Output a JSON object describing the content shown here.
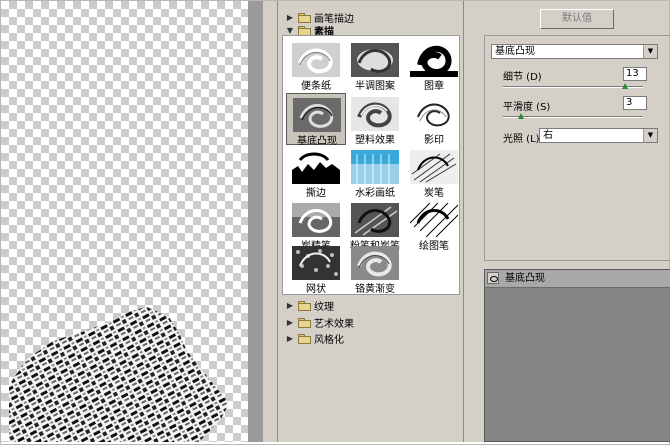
{
  "gallery": {
    "categories_top": [
      {
        "label": "画笔描边",
        "expanded": false
      }
    ],
    "active_category": {
      "label": "素描",
      "expanded": true
    },
    "thumbnails": [
      {
        "label": "便条纸",
        "selected": false
      },
      {
        "label": "半调图案",
        "selected": false
      },
      {
        "label": "图章",
        "selected": false
      },
      {
        "label": "基底凸现",
        "selected": true
      },
      {
        "label": "塑料效果",
        "selected": false
      },
      {
        "label": "影印",
        "selected": false
      },
      {
        "label": "撕边",
        "selected": false
      },
      {
        "label": "水彩画纸",
        "selected": false
      },
      {
        "label": "炭笔",
        "selected": false
      },
      {
        "label": "炭精笔",
        "selected": false
      },
      {
        "label": "粉笔和炭笔",
        "selected": false
      },
      {
        "label": "绘图笔",
        "selected": false
      },
      {
        "label": "网状",
        "selected": false
      },
      {
        "label": "铬黄渐变",
        "selected": false
      }
    ],
    "categories_bottom": [
      {
        "label": "纹理",
        "expanded": false
      },
      {
        "label": "艺术效果",
        "expanded": false
      },
      {
        "label": "风格化",
        "expanded": false
      }
    ]
  },
  "settings": {
    "defaults_button": "默认值",
    "filter_select": "基底凸现",
    "detail": {
      "label": "细节 (D)",
      "value": "13",
      "fraction": 0.87
    },
    "smoothness": {
      "label": "平滑度 (S)",
      "value": "3",
      "fraction": 0.13
    },
    "light": {
      "label": "光照 (L):",
      "value": "右"
    }
  },
  "layers": {
    "items": [
      {
        "label": "基底凸现",
        "visible": true
      }
    ]
  },
  "colors": {
    "panel_bg": "#d4d0c8",
    "layer_area": "#848484",
    "slider_thumb": "#2a8a2a"
  }
}
